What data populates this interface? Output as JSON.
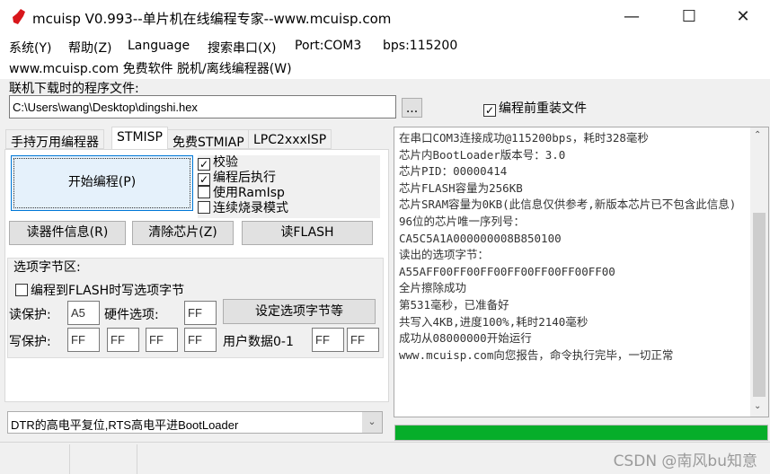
{
  "window": {
    "title": "mcuisp V0.993--单片机在线编程专家--www.mcuisp.com",
    "minimize": "—",
    "maximize": "☐",
    "close": "✕"
  },
  "menu": {
    "items": [
      "系统(Y)",
      "帮助(Z)",
      "Language",
      "搜索串口(X)",
      "Port:COM3",
      "bps:115200"
    ],
    "row2": "www.mcuisp.com 免费软件 脱机/离线编程器(W)"
  },
  "file": {
    "label": "联机下载时的程序文件:",
    "path": "C:\\Users\\wang\\Desktop\\dingshi.hex",
    "browse": "...",
    "reload_label": "编程前重装文件",
    "reload_checked": true
  },
  "tabs": [
    {
      "label": "手持万用编程器"
    },
    {
      "label": "STMISP",
      "active": true
    },
    {
      "label": "免费STMIAP"
    },
    {
      "label": "LPC2xxxISP"
    }
  ],
  "stmisp": {
    "start": "开始编程(P)",
    "options": [
      {
        "label": "校验",
        "checked": true
      },
      {
        "label": "编程后执行",
        "checked": true
      },
      {
        "label": "使用RamIsp",
        "checked": false
      },
      {
        "label": "连续烧录模式",
        "checked": false
      }
    ],
    "read_info": "读器件信息(R)",
    "erase": "清除芯片(Z)",
    "read_flash": "读FLASH",
    "group": {
      "title": "选项字节区:",
      "write_opt_label": "编程到FLASH时写选项字节",
      "write_opt_checked": false,
      "read_protect_label": "读保护:",
      "read_protect": "A5",
      "hw_label": "硬件选项:",
      "hw": "FF",
      "set_btn": "设定选项字节等",
      "write_protect_label": "写保护:",
      "write_protect": [
        "FF",
        "FF",
        "FF",
        "FF"
      ],
      "user_label": "用户数据0-1",
      "user": [
        "FF",
        "FF"
      ]
    }
  },
  "reset_mode": "DTR的高电平复位,RTS高电平进BootLoader",
  "log": "在串口COM3连接成功@115200bps，耗时328毫秒\n芯片内BootLoader版本号：3.0\n芯片PID：00000414\n芯片FLASH容量为256KB\n芯片SRAM容量为0KB(此信息仅供参考,新版本芯片已不包含此信息)\n96位的芯片唯一序列号：\nCA5C5A1A000000008B850100\n读出的选项字节：\nA55AFF00FF00FF00FF00FF00FF00FF00\n全片擦除成功\n第531毫秒，已准备好\n共写入4KB,进度100%,耗时2140毫秒\n成功从08000000开始运行\nwww.mcuisp.com向您报告，命令执行完毕，一切正常",
  "progress": {
    "percent": 100,
    "color": "#06ae2a"
  },
  "watermark": "CSDN @南风bu知意"
}
